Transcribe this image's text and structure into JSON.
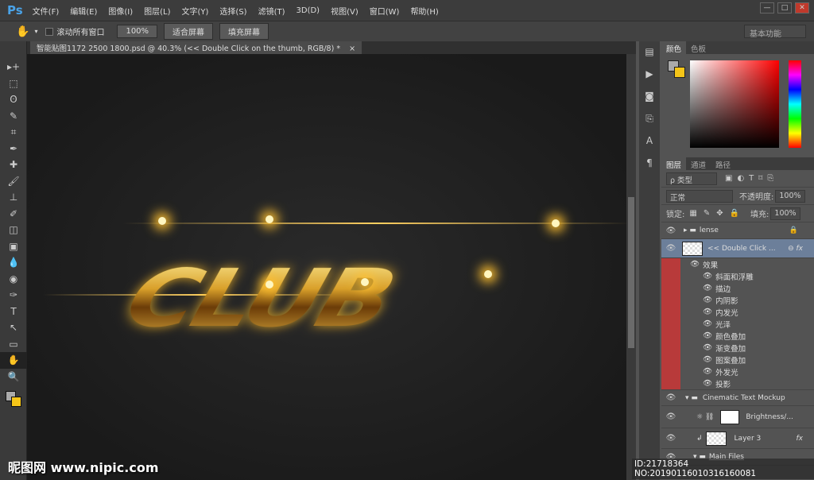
{
  "app": {
    "logo": "Ps",
    "menus": [
      "文件(F)",
      "编辑(E)",
      "图像(I)",
      "图层(L)",
      "文字(Y)",
      "选择(S)",
      "滤镜(T)",
      "3D(D)",
      "视图(V)",
      "窗口(W)",
      "帮助(H)"
    ],
    "window_buttons": [
      "—",
      "□",
      "✕"
    ]
  },
  "options": {
    "scroll_all": "滚动所有窗口",
    "btn_100": "100%",
    "btn_fit": "适合屏幕",
    "btn_fill": "填充屏幕",
    "workspace": "基本功能"
  },
  "document": {
    "tab_title": "智能贴图1172 2500 1800.psd @ 40.3% (<< Double Click on the thumb, RGB/8) *",
    "close": "×",
    "artwork_text": "CLUB"
  },
  "tools": [
    "▸+",
    "⬚",
    "ʘ",
    "✎",
    "⌗",
    "✒",
    "✚",
    "🖌",
    "⊥",
    "✐",
    "◫",
    "▣",
    "💧",
    "◉",
    "✑",
    "T",
    "↖",
    "▭",
    "✋",
    "🔍"
  ],
  "color_panel": {
    "tabs": [
      "颜色",
      "色板"
    ]
  },
  "layers_panel": {
    "tabs": [
      "图层",
      "通道",
      "路径"
    ],
    "filter": "ρ 类型",
    "blend_mode": "正常",
    "opacity_label": "不透明度:",
    "opacity": "100%",
    "lock_label": "锁定:",
    "fill_label": "填充:",
    "fill": "100%",
    "layers": [
      {
        "name": "lense"
      },
      {
        "name": "<< Double Click ..."
      }
    ],
    "effects_label": "效果",
    "effects": [
      "斜面和浮雕",
      "描边",
      "内阴影",
      "内发光",
      "光泽",
      "颜色叠加",
      "渐变叠加",
      "图案叠加",
      "外发光",
      "投影"
    ],
    "layers2": [
      {
        "name": "Cinematic Text Mockup"
      },
      {
        "name": "Brightness/..."
      },
      {
        "name": "Layer 3"
      },
      {
        "name": "Main Files"
      }
    ]
  },
  "watermark": {
    "left": "昵图网 www.nipic.com",
    "right": "ID:21718364 NO:20190116010316160081"
  }
}
